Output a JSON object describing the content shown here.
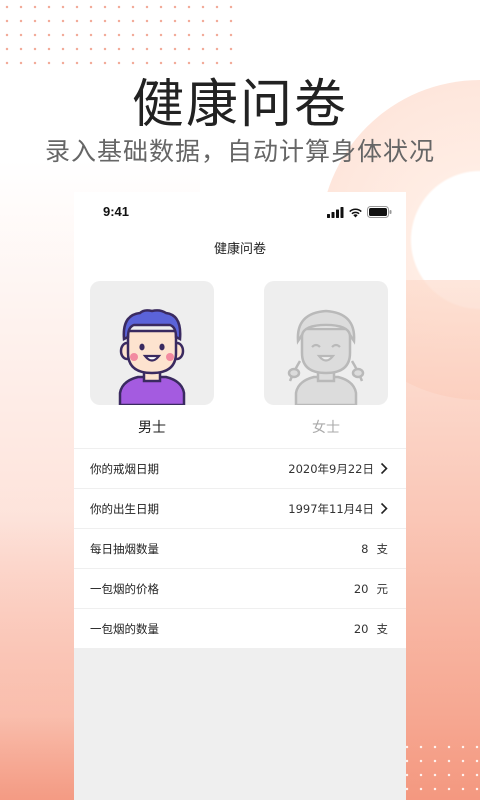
{
  "promo": {
    "headline": "健康问卷",
    "subheadline": "录入基础数据，自动计算身体状况"
  },
  "status_bar": {
    "time": "9:41"
  },
  "page": {
    "title": "健康问卷"
  },
  "gender": {
    "male_label": "男士",
    "female_label": "女士",
    "selected": "男士"
  },
  "form": {
    "rows": [
      {
        "label": "你的戒烟日期",
        "value": "2020年9月22日",
        "unit": ""
      },
      {
        "label": "你的出生日期",
        "value": "1997年11月4日",
        "unit": ""
      },
      {
        "label": "每日抽烟数量",
        "value": "8",
        "unit": "支"
      },
      {
        "label": "一包烟的价格",
        "value": "20",
        "unit": "元"
      },
      {
        "label": "一包烟的数量",
        "value": "20",
        "unit": "支"
      }
    ]
  },
  "colors": {
    "accent": "#f39a82",
    "avatar_hair": "#5b63d9",
    "avatar_shirt": "#a45be0",
    "avatar_skin": "#fde3cf"
  },
  "icons": {
    "signal": "signal-icon",
    "wifi": "wifi-icon",
    "battery": "battery-icon",
    "chevron": "chevron-right-icon"
  }
}
